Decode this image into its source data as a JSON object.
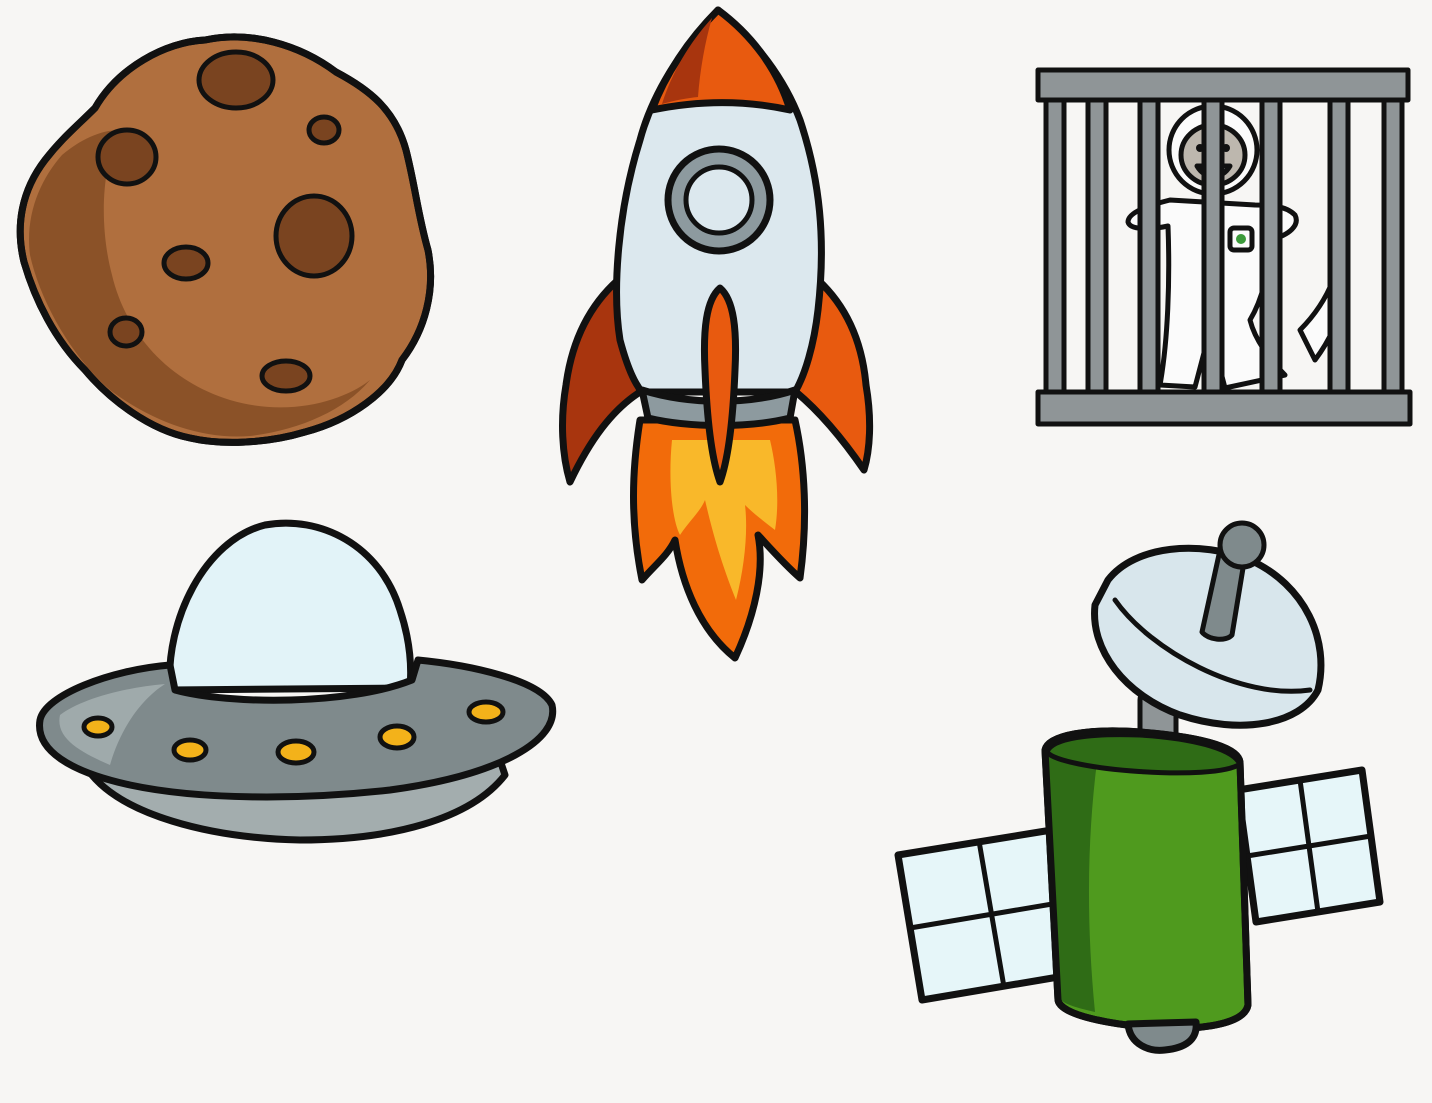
{
  "palette": {
    "background": "#f7f6f4",
    "outline": "#111111",
    "asteroid": "#b06f3e",
    "asteroid_shadow": "#8b5228",
    "asteroid_crater": "#7a4420",
    "rocket_body": "#dce8ee",
    "rocket_gray": "#8d9a9f",
    "rocket_orange": "#e85a0f",
    "rocket_dark_orange": "#a8350e",
    "flame_orange": "#f26b0a",
    "flame_yellow": "#f9b82a",
    "ufo_dome": "#e2f3f8",
    "ufo_hull": "#7f8a8c",
    "ufo_hull_light": "#a3adae",
    "ufo_lights": "#f3b21a",
    "cage_bars": "#8f9597",
    "satellite_green": "#4f9a1e",
    "satellite_green_dark": "#2f6c16",
    "satellite_panel": "#e6f6f9",
    "satellite_dish": "#d8e6ec"
  },
  "icons": {
    "asteroid": "asteroid-icon",
    "rocket": "rocket-icon",
    "caged_astronaut": "caged-astronaut-icon",
    "ufo": "ufo-icon",
    "satellite": "satellite-icon"
  }
}
